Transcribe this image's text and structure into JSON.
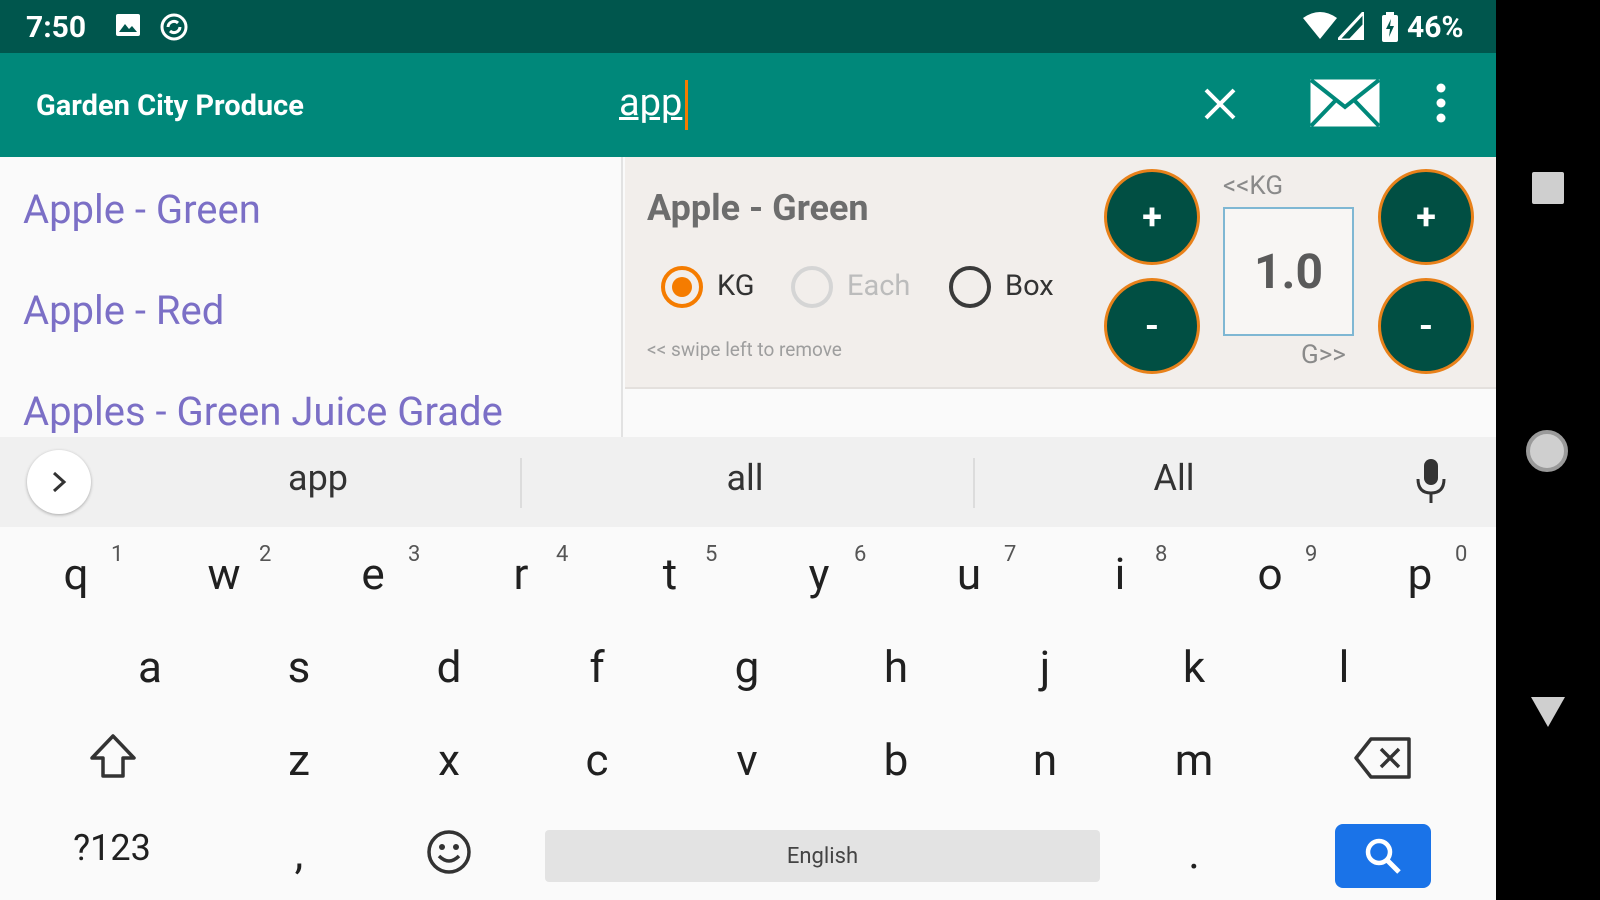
{
  "status_bar": {
    "time": "7:50",
    "battery": "46%",
    "icons": [
      "image-icon",
      "sync-icon",
      "wifi-icon",
      "cell-signal-icon",
      "battery-icon"
    ]
  },
  "app_bar": {
    "title": "Garden City Produce",
    "search_value": "app",
    "icons": [
      "close-icon",
      "email-icon",
      "overflow-menu-icon"
    ]
  },
  "list": {
    "items": [
      {
        "label": "Apple - Green"
      },
      {
        "label": "Apple - Red"
      },
      {
        "label": "Apples - Green Juice Grade"
      }
    ]
  },
  "detail": {
    "title": "Apple - Green",
    "units": [
      {
        "label": "KG",
        "selected": true,
        "enabled": true
      },
      {
        "label": "Each",
        "selected": false,
        "enabled": false
      },
      {
        "label": "Box",
        "selected": false,
        "enabled": true
      }
    ],
    "swipe_hint": "<< swipe left to remove",
    "quantity": "1.0",
    "left_unit_label": "<<KG",
    "right_unit_label": "G>>",
    "plus_label": "+",
    "minus_label": "-"
  },
  "keyboard": {
    "suggestions": [
      "app",
      "all",
      "All"
    ],
    "row1": [
      {
        "k": "q",
        "h": "1"
      },
      {
        "k": "w",
        "h": "2"
      },
      {
        "k": "e",
        "h": "3"
      },
      {
        "k": "r",
        "h": "4"
      },
      {
        "k": "t",
        "h": "5"
      },
      {
        "k": "y",
        "h": "6"
      },
      {
        "k": "u",
        "h": "7"
      },
      {
        "k": "i",
        "h": "8"
      },
      {
        "k": "o",
        "h": "9"
      },
      {
        "k": "p",
        "h": "0"
      }
    ],
    "row2": [
      "a",
      "s",
      "d",
      "f",
      "g",
      "h",
      "j",
      "k",
      "l"
    ],
    "row3": [
      "z",
      "x",
      "c",
      "v",
      "b",
      "n",
      "m"
    ],
    "symbols_label": "?123",
    "comma_label": ",",
    "period_label": ".",
    "space_label": "English",
    "accent_color": "#1a73e8"
  },
  "colors": {
    "status_bar": "#00564d",
    "app_bar": "#00887a",
    "button": "#014f43",
    "accent": "#f57c00",
    "link": "#7b6fc6"
  }
}
